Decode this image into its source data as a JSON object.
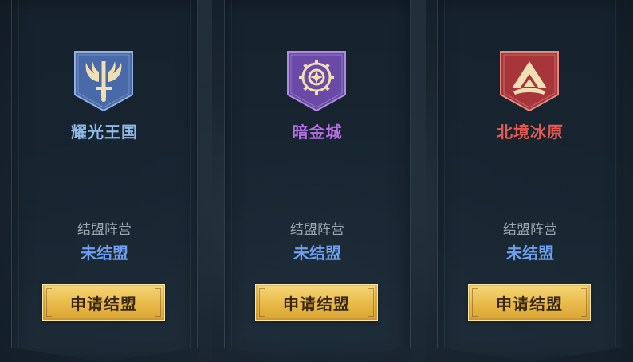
{
  "colors": {
    "accent_blue": "#7eb2e8",
    "accent_purple": "#b06ae0",
    "accent_red": "#e2554f",
    "status_blue": "#6e9ef0"
  },
  "factions": [
    {
      "name": "耀光王国",
      "emblem_icon": "winged-sword-icon",
      "emblem_color": "#4a69a8",
      "name_color": "#8fb8e6",
      "alliance_label": "结盟阵营",
      "alliance_status": "未结盟",
      "button_label": "申请结盟"
    },
    {
      "name": "暗金城",
      "emblem_icon": "compass-gear-icon",
      "emblem_color": "#6a4aa6",
      "name_color": "#b86ee6",
      "alliance_label": "结盟阵营",
      "alliance_status": "未结盟",
      "button_label": "申请结盟"
    },
    {
      "name": "北境冰原",
      "emblem_icon": "mountain-peak-icon",
      "emblem_color": "#a8353a",
      "name_color": "#e25a52",
      "alliance_label": "结盟阵营",
      "alliance_status": "未结盟",
      "button_label": "申请结盟"
    }
  ]
}
